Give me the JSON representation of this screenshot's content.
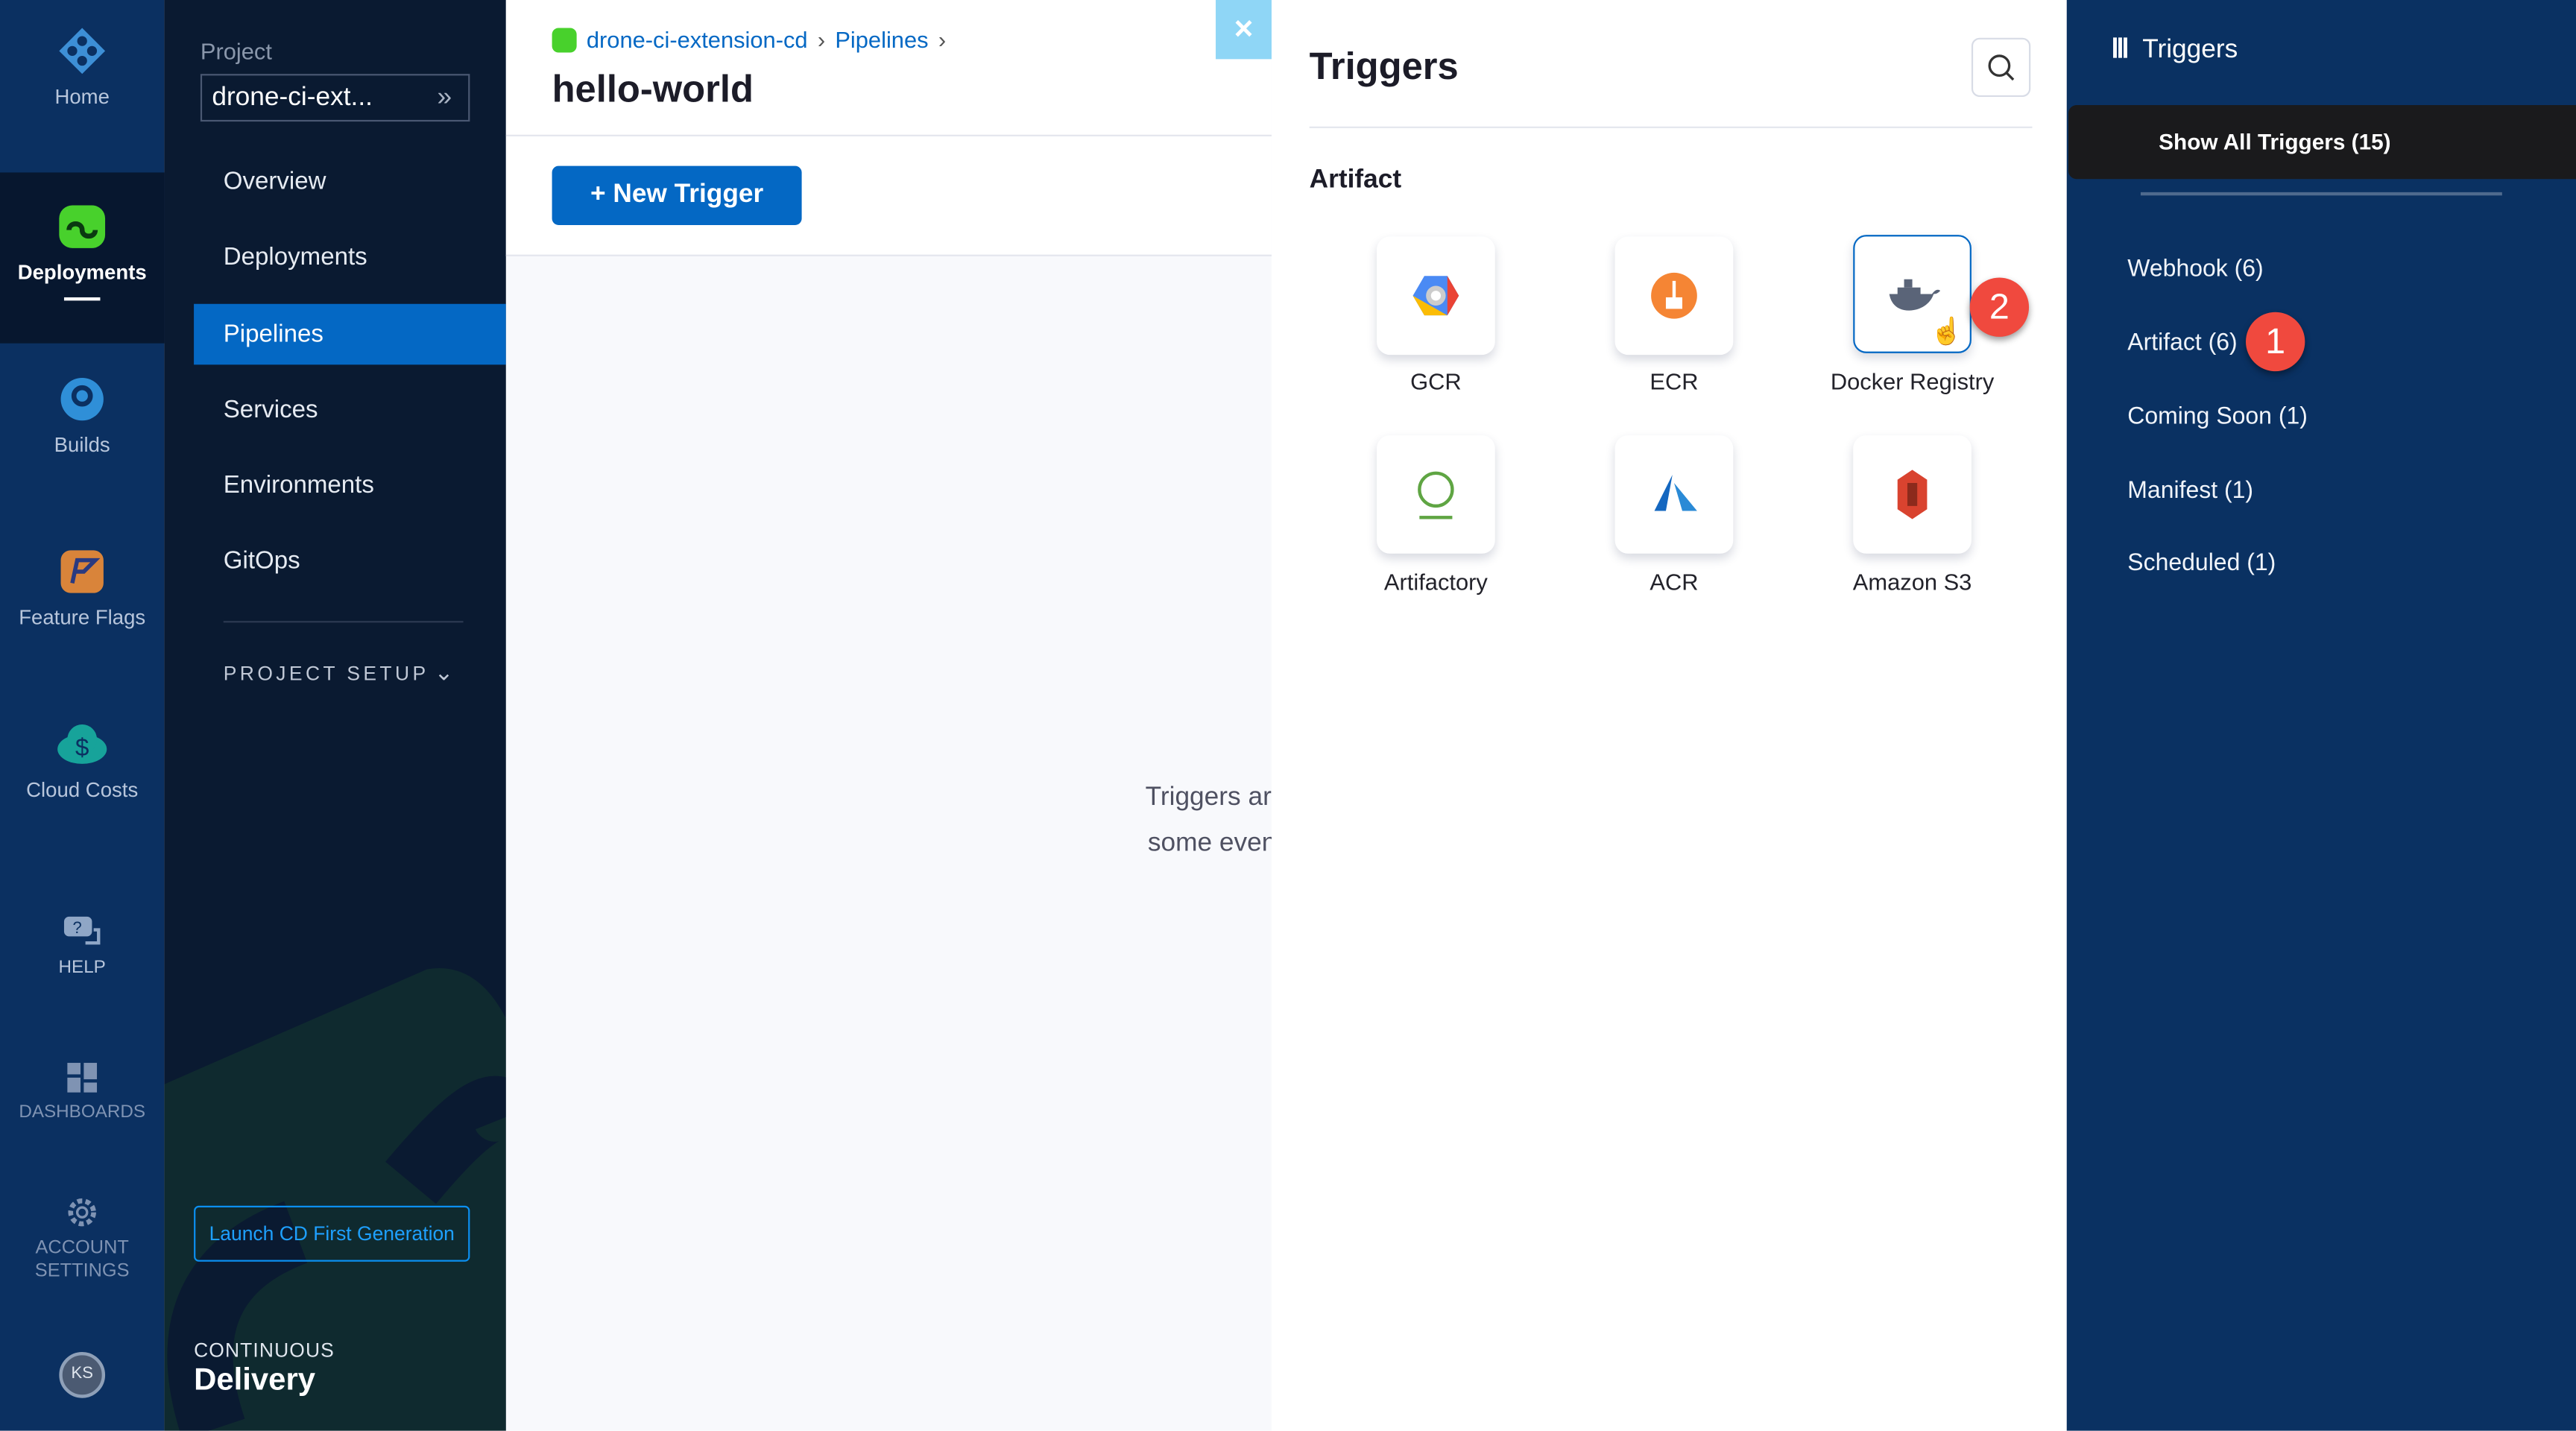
{
  "rail": {
    "items": [
      {
        "label": "Home"
      },
      {
        "label": "Deployments"
      },
      {
        "label": "Builds"
      },
      {
        "label": "Feature Flags"
      },
      {
        "label": "Cloud Costs"
      },
      {
        "label": "HELP"
      },
      {
        "label": "DASHBOARDS"
      },
      {
        "label": "ACCOUNT SETTINGS"
      }
    ],
    "avatar": "KS"
  },
  "sidebar": {
    "project_label": "Project",
    "project_value": "drone-ci-ext...",
    "items": [
      {
        "label": "Overview"
      },
      {
        "label": "Deployments"
      },
      {
        "label": "Pipelines"
      },
      {
        "label": "Services"
      },
      {
        "label": "Environments"
      },
      {
        "label": "GitOps"
      }
    ],
    "project_setup": "PROJECT SETUP",
    "launch_button": "Launch CD First Generation",
    "module_small": "CONTINUOUS",
    "module_big": "Delivery"
  },
  "main": {
    "breadcrumb": [
      "drone-ci-extension-cd",
      "Pipelines"
    ],
    "title": "hello-world",
    "new_trigger": "+ New Trigger",
    "empty_line1": "Triggers are",
    "empty_line2": "some event"
  },
  "drawer": {
    "title": "Triggers",
    "section": "Artifact",
    "tiles": [
      {
        "label": "GCR"
      },
      {
        "label": "ECR"
      },
      {
        "label": "Docker Registry"
      },
      {
        "label": "Artifactory"
      },
      {
        "label": "ACR"
      },
      {
        "label": "Amazon S3"
      }
    ]
  },
  "panel": {
    "title": "Triggers",
    "show_all": "Show All Triggers (15)",
    "categories": [
      {
        "label": "Webhook (6)"
      },
      {
        "label": "Artifact (6)"
      },
      {
        "label": "Coming Soon (1)"
      },
      {
        "label": "Manifest (1)"
      },
      {
        "label": "Scheduled (1)"
      }
    ]
  },
  "annotations": {
    "step1": "1",
    "step2": "2"
  },
  "colors": {
    "accent": "#0468c4",
    "rail": "#0b3061",
    "badge": "#f0493e"
  }
}
